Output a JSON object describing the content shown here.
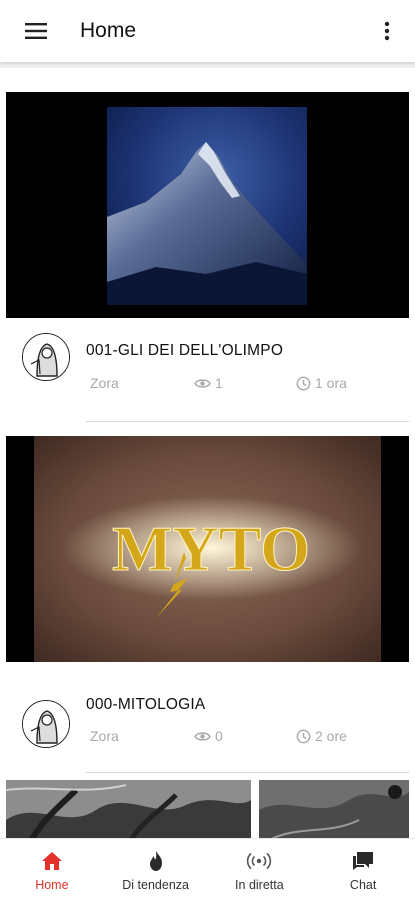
{
  "app_bar": {
    "title": "Home",
    "menu_icon": "hamburger-menu-icon",
    "more_icon": "more-vert-icon"
  },
  "videos": [
    {
      "title": "001-GLI DEI DELL'OLIMPO",
      "author": "Zora",
      "views": "1",
      "time": "1 ora",
      "thumbnail": "mountain-peak-night-image"
    },
    {
      "title": "000-MITOLOGIA",
      "author": "Zora",
      "views": "0",
      "time": "2 ore",
      "thumbnail": "myto-logo-image",
      "thumbnail_text": "MYTO"
    }
  ],
  "bottom_nav": [
    {
      "label": "Home",
      "icon": "home-icon",
      "active": true
    },
    {
      "label": "Di tendenza",
      "icon": "flame-icon",
      "active": false
    },
    {
      "label": "In diretta",
      "icon": "broadcast-icon",
      "active": false
    },
    {
      "label": "Chat",
      "icon": "chat-icon",
      "active": false
    }
  ],
  "colors": {
    "accent": "#e3322b",
    "meta_text": "#a8a8a8",
    "app_bar": "#ffffff"
  }
}
